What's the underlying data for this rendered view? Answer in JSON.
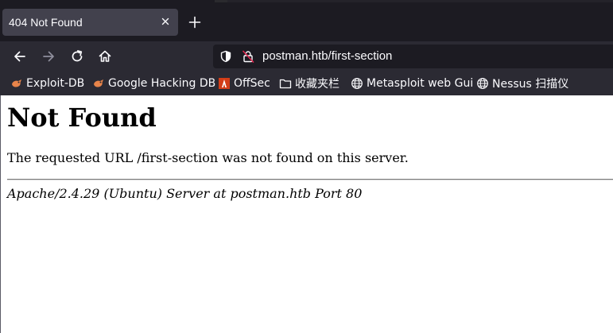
{
  "theme": {
    "chrome_dark": "#1c1b22",
    "toolbar": "#2b2a33",
    "tab_active": "#42414d",
    "text_light": "#fbfbfe",
    "disabled": "#8f8f9d",
    "page_bg": "#ffffff"
  },
  "tabs": [
    {
      "title": "404 Not Found",
      "active": true
    }
  ],
  "navigation": {
    "back": "arrow-left-icon",
    "forward": "arrow-right-icon",
    "forward_enabled": false,
    "reload": "reload-icon",
    "home": "home-icon"
  },
  "urlbar": {
    "url": "postman.htb/first-section",
    "security_icon": "shield-icon",
    "connection_icon": "insecure-lock-icon"
  },
  "bookmarks": [
    {
      "label": "Exploit-DB",
      "icon": "exploit-db-icon"
    },
    {
      "label": "Google Hacking DB",
      "icon": "ghdb-icon"
    },
    {
      "label": "OffSec",
      "icon": "offsec-icon"
    },
    {
      "label": "收藏夹栏",
      "icon": "folder-icon"
    },
    {
      "label": "Metasploit web Gui",
      "icon": "globe-icon"
    },
    {
      "label": "Nessus 扫描仪",
      "icon": "globe-icon"
    }
  ],
  "page": {
    "heading": "Not Found",
    "message": "The requested URL /first-section was not found on this server.",
    "server_signature": "Apache/2.4.29 (Ubuntu) Server at postman.htb Port 80"
  }
}
